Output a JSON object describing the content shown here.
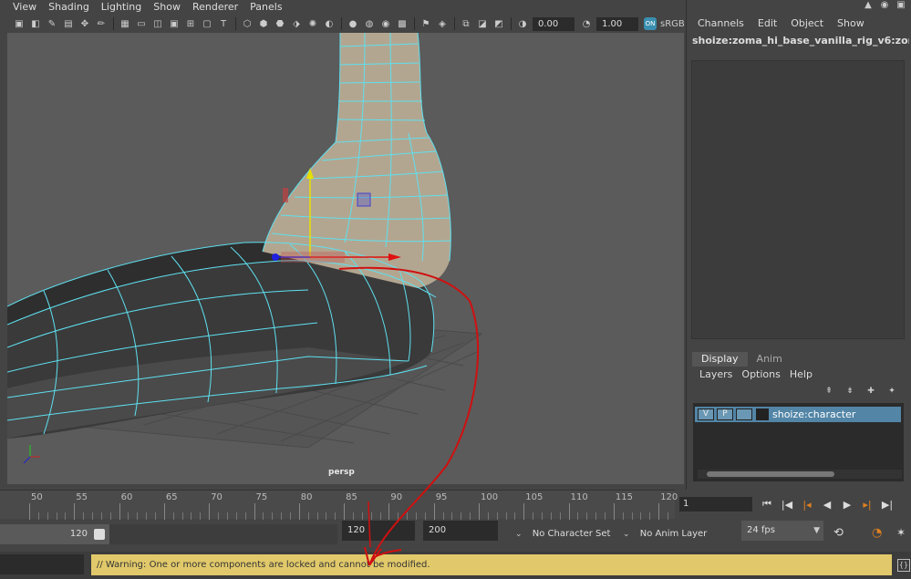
{
  "viewport": {
    "menu": [
      "View",
      "Shading",
      "Lighting",
      "Show",
      "Renderer",
      "Panels"
    ],
    "toolbar": {
      "exposure_value": "0.00",
      "gamma_value": "1.00",
      "color_space": "sRGB",
      "badge": "ON"
    },
    "camera_label": "persp"
  },
  "channel_box": {
    "menu": [
      "Channels",
      "Edit",
      "Object",
      "Show"
    ],
    "node_name": "shoize:zoma_hi_base_vanilla_rig_v6:zom..."
  },
  "layer_editor": {
    "tabs": [
      "Display",
      "Anim"
    ],
    "active_tab": "Display",
    "menu": [
      "Layers",
      "Options",
      "Help"
    ],
    "layers": [
      {
        "visible": "V",
        "playback": "P",
        "name": "shoize:character"
      }
    ]
  },
  "time_slider": {
    "ticks": [
      50,
      55,
      60,
      65,
      70,
      75,
      80,
      85,
      90,
      95,
      100,
      105,
      110,
      115,
      120
    ],
    "current_frame": "1"
  },
  "range_slider": {
    "range_end_bar": "120",
    "playback_end": "120",
    "animation_end": "200",
    "character_set": "No Character Set",
    "anim_layer": "No Anim Layer",
    "fps": "24 fps"
  },
  "status": {
    "warning": "// Warning: One or more components are locked and cannot be modified."
  },
  "colors": {
    "wireframe": "#5ee0f0",
    "warning_bg": "#e1c96b",
    "layer_selected": "#5285a6",
    "annotation": "#d01010"
  }
}
